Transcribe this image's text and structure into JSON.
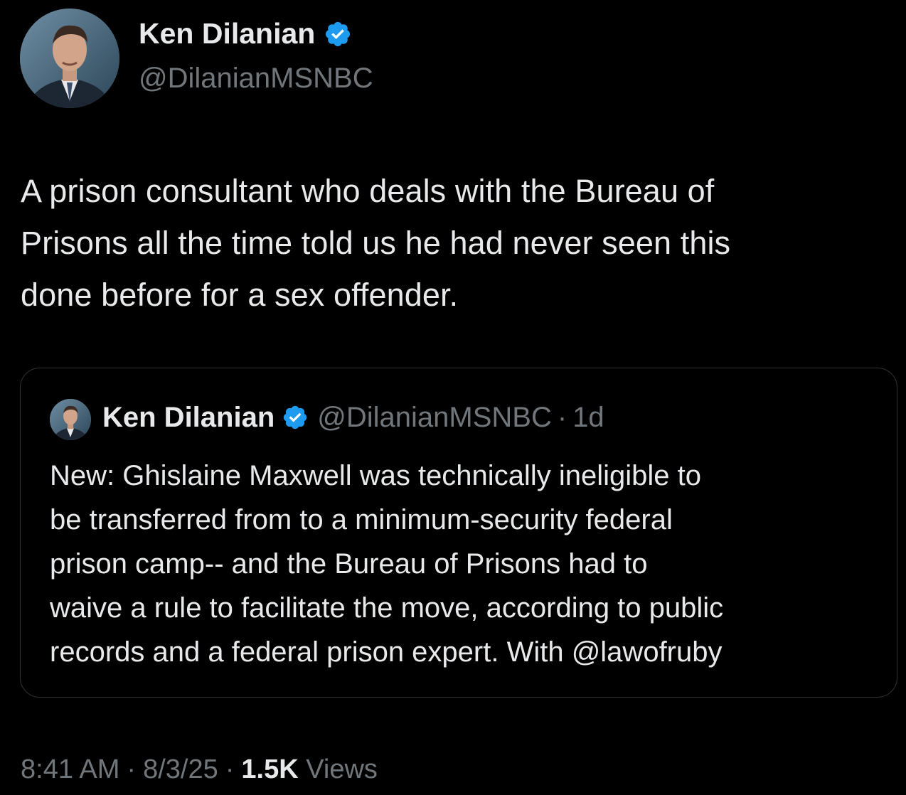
{
  "author": {
    "name": "Ken Dilanian",
    "handle": "@DilanianMSNBC",
    "verified_color": "#1d9bf0"
  },
  "tweet": {
    "text": "A prison consultant who deals with the Bureau of\nPrisons all the time told us he had never seen this\ndone before for a sex offender."
  },
  "quoted_tweet": {
    "name": "Ken Dilanian",
    "handle": "@DilanianMSNBC",
    "separator": "·",
    "time": "1d",
    "text": "New: Ghislaine Maxwell was technically ineligible to\nbe transferred from to a minimum-security federal\nprison camp-- and the Bureau of Prisons had to\nwaive a rule to facilitate the move, according to public\nrecords and a federal prison expert. With @lawofruby"
  },
  "meta": {
    "time": "8:41 AM",
    "date": "8/3/25",
    "separator": "·",
    "views_count": "1.5K",
    "views_label": "Views"
  },
  "icons": {
    "verified": "verified-badge-icon"
  }
}
